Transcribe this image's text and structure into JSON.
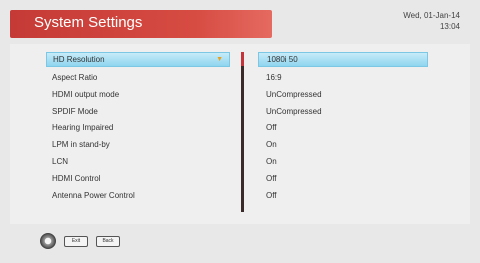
{
  "header": {
    "title": "System Settings",
    "date": "Wed, 01-Jan-14",
    "time": "13:04"
  },
  "menu": {
    "items": [
      {
        "label": "HD Resolution",
        "value": "1080i 50"
      },
      {
        "label": "Aspect Ratio",
        "value": "16:9"
      },
      {
        "label": "HDMI output mode",
        "value": "UnCompressed"
      },
      {
        "label": "SPDIF Mode",
        "value": "UnCompressed"
      },
      {
        "label": "Hearing Impaired",
        "value": "Off"
      },
      {
        "label": "LPM in stand-by",
        "value": "On"
      },
      {
        "label": "LCN",
        "value": "On"
      },
      {
        "label": "HDMI Control",
        "value": "Off"
      },
      {
        "label": "Antenna Power Control",
        "value": "Off"
      }
    ],
    "selected_index": 0
  },
  "footer": {
    "exit_label": "Exit",
    "back_label": "Back"
  },
  "icons": {
    "nav": "navigation-pad-icon",
    "selected_arrow": "chevron-down-icon"
  },
  "colors": {
    "title_bar": "#d64b42",
    "highlight": "#8fd5ef",
    "divider_accent": "#c5343a"
  }
}
